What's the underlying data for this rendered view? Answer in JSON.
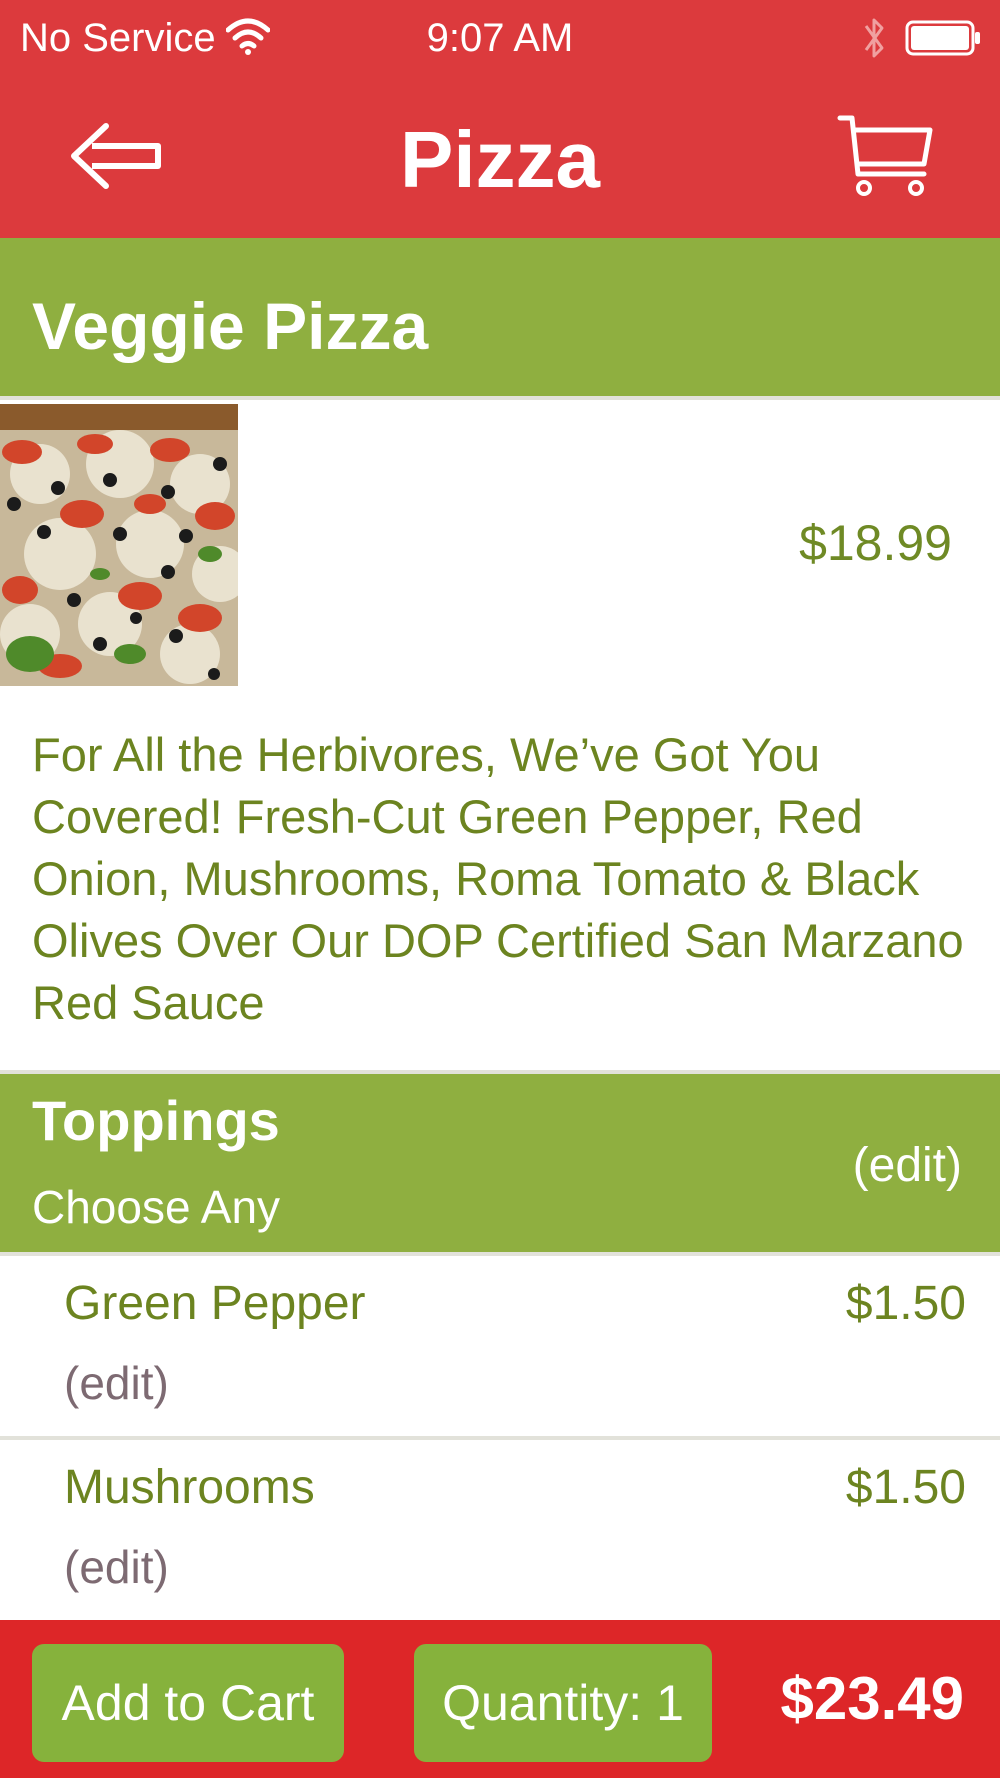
{
  "status_bar": {
    "carrier": "No Service",
    "time": "9:07 AM",
    "icons": [
      "wifi-icon",
      "bluetooth-icon",
      "battery-icon"
    ]
  },
  "nav": {
    "title": "Pizza",
    "back_icon": "arrow-left-icon",
    "cart_icon": "shopping-cart-icon"
  },
  "product": {
    "name": "Veggie Pizza",
    "price": "$18.99",
    "description": "For All the Herbivores, We’ve Got You Covered! Fresh-Cut Green Pepper, Red Onion, Mushrooms, Roma Tomato & Black Olives Over Our DOP Certified San Marzano Red Sauce"
  },
  "toppings": {
    "title": "Toppings",
    "subtitle": "Choose Any",
    "edit_label": "(edit)",
    "items": [
      {
        "name": "Green Pepper",
        "price": "$1.50",
        "edit_label": "(edit)"
      },
      {
        "name": "Mushrooms",
        "price": "$1.50",
        "edit_label": "(edit)"
      }
    ]
  },
  "footer": {
    "add_to_cart_label": "Add to Cart",
    "quantity_label": "Quantity: 1",
    "total": "$23.49"
  },
  "colors": {
    "nav_red": "#dc3a3d",
    "footer_red": "#dd2628",
    "section_green": "#8faf40",
    "button_green": "#86b23c",
    "text_green": "#6c8420",
    "edit_gray": "#7d6a72"
  }
}
